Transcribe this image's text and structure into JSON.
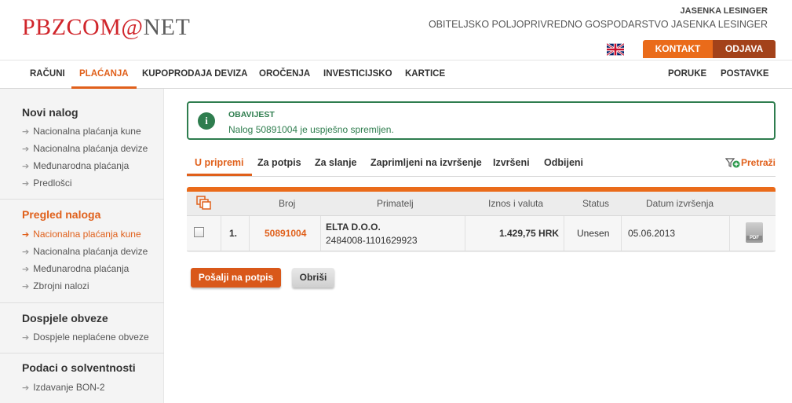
{
  "header": {
    "logo_part1": "PBZCOM",
    "logo_part2": "@",
    "logo_part3": "NET",
    "user_name": "JASENKA LESINGER",
    "user_company": "OBITELJSKO POLJOPRIVREDNO GOSPODARSTVO JASENKA LESINGER",
    "contact_label": "KONTAKT",
    "logout_label": "ODJAVA",
    "language_flag": "uk-flag-icon"
  },
  "mainnav": {
    "items": [
      {
        "label": "RAČUNI"
      },
      {
        "label": "PLAĆANJA"
      },
      {
        "label": "KUPOPRODAJA DEVIZA"
      },
      {
        "label": "OROČENJA"
      },
      {
        "label": "INVESTICIJSKO"
      },
      {
        "label": "KARTICE"
      }
    ],
    "right_items": [
      {
        "label": "PORUKE"
      },
      {
        "label": "POSTAVKE"
      }
    ],
    "active": "PLAĆANJA"
  },
  "sidebar": {
    "sections": [
      {
        "title": "Novi nalog",
        "items": [
          "Nacionalna plaćanja kune",
          "Nacionalna plaćanja devize",
          "Međunarodna plaćanja",
          "Predlošci"
        ]
      },
      {
        "title": "Pregled naloga",
        "items": [
          "Nacionalna plaćanja kune",
          "Nacionalna plaćanja devize",
          "Međunarodna plaćanja",
          "Zbrojni nalozi"
        ]
      },
      {
        "title": "Dospjele obveze",
        "items": [
          "Dospjele neplaćene obveze"
        ]
      },
      {
        "title": "Podaci o solventnosti",
        "items": [
          "Izdavanje BON-2"
        ]
      }
    ],
    "active_item": "Nacionalna plaćanja kune"
  },
  "notice": {
    "icon": "info-icon",
    "icon_glyph": "i",
    "title": "OBAVIJEST",
    "text": "Nalog 50891004 je uspješno spremljen."
  },
  "subtabs": {
    "items": [
      {
        "label": "U pripremi"
      },
      {
        "label": "Za potpis"
      },
      {
        "label": "Za slanje"
      },
      {
        "label": "Zaprimljeni na izvršenje"
      },
      {
        "label": "Izvršeni"
      },
      {
        "label": "Odbijeni"
      }
    ],
    "active": "U pripremi",
    "search_label": "Pretraži"
  },
  "table": {
    "headers": {
      "copy_icon": "copy-icon",
      "number": "Broj",
      "recipient": "Primatelj",
      "amount": "Iznos i valuta",
      "status": "Status",
      "date": "Datum izvršenja"
    },
    "rows": [
      {
        "index": "1.",
        "number": "50891004",
        "recipient_name": "ELTA D.O.O.",
        "recipient_account": "2484008-1101629923",
        "amount": "1.429,75 HRK",
        "status": "Unesen",
        "date": "05.06.2013",
        "pdf_label": "PDF"
      }
    ]
  },
  "actions": {
    "send_label": "Pošalji na potpis",
    "delete_label": "Obriši"
  },
  "colors": {
    "accent": "#e0601b",
    "brand_red": "#d0252b",
    "success_green": "#2e7d4e",
    "logout_brown": "#a3421a"
  }
}
